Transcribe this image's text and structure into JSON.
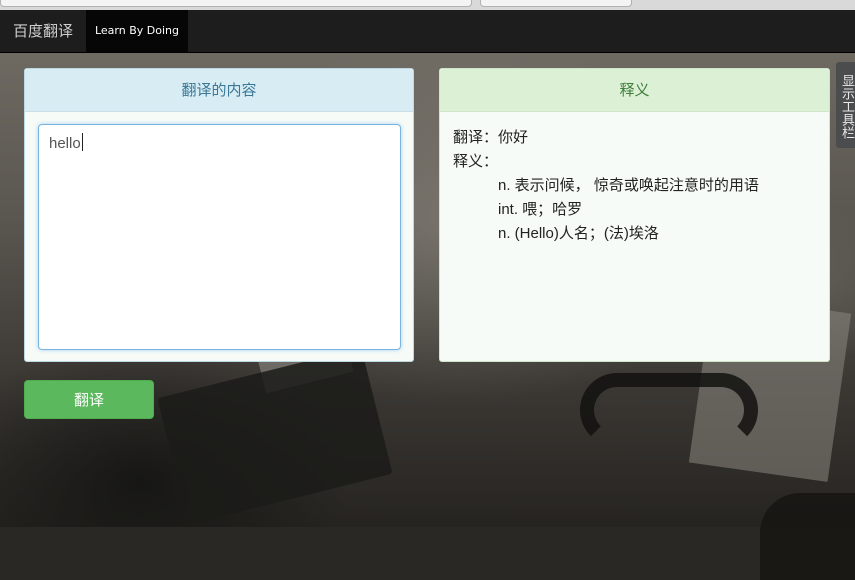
{
  "navbar": {
    "brand": "百度翻译",
    "active_item": "Learn By Doing"
  },
  "input_panel": {
    "title": "翻译的内容",
    "text_value": "hello"
  },
  "result_panel": {
    "title": "释义",
    "translation_line": "翻译：你好",
    "definition_label": "释义：",
    "definitions": [
      "n. 表示问候， 惊奇或唤起注意时的用语",
      "int. 喂；哈罗",
      "n. (Hello)人名；(法)埃洛"
    ]
  },
  "actions": {
    "translate_button": "翻译"
  },
  "side_toolbar": {
    "label": "显示工具栏"
  },
  "colors": {
    "navbar_bg": "#1d1d1d",
    "input_header_bg": "#d8ecf4",
    "result_header_bg": "#dcf0d6",
    "button_green": "#5cb85c"
  }
}
